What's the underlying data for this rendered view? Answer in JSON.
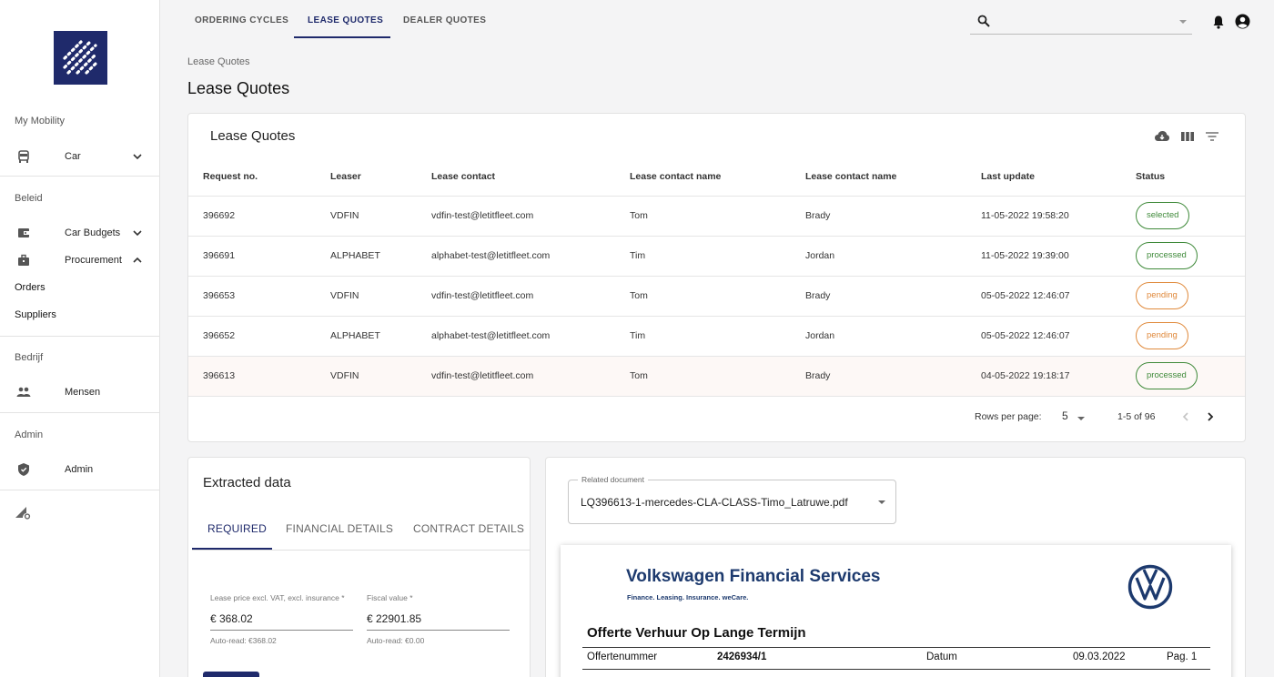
{
  "sidebar": {
    "logo": "brand-logo",
    "sections": {
      "my_mobility": "My Mobility",
      "beleid": "Beleid",
      "bedrijf": "Bedrijf",
      "admin": "Admin"
    },
    "items": {
      "car": "Car",
      "car_budgets": "Car Budgets",
      "procurement": "Procurement",
      "orders": "Orders",
      "suppliers": "Suppliers",
      "mensen": "Mensen",
      "admin": "Admin"
    }
  },
  "topbar": {
    "tabs": [
      "ORDERING CYCLES",
      "LEASE QUOTES",
      "DEALER QUOTES"
    ],
    "active_tab": "LEASE QUOTES",
    "search_placeholder": ""
  },
  "page": {
    "breadcrumb": "Lease Quotes",
    "title": "Lease Quotes"
  },
  "table": {
    "title": "Lease Quotes",
    "columns": [
      "Request no.",
      "Leaser",
      "Lease contact",
      "Lease contact name",
      "Lease contact name",
      "Last update",
      "Status"
    ],
    "rows": [
      {
        "request": "396692",
        "leaser": "VDFIN",
        "contact": "vdfin-test@letitfleet.com",
        "first": "Tom",
        "last": "Brady",
        "updated": "11-05-2022 19:58:20",
        "status": "selected"
      },
      {
        "request": "396691",
        "leaser": "ALPHABET",
        "contact": "alphabet-test@letitfleet.com",
        "first": "Tim",
        "last": "Jordan",
        "updated": "11-05-2022 19:39:00",
        "status": "processed"
      },
      {
        "request": "396653",
        "leaser": "VDFIN",
        "contact": "vdfin-test@letitfleet.com",
        "first": "Tom",
        "last": "Brady",
        "updated": "05-05-2022 12:46:07",
        "status": "pending"
      },
      {
        "request": "396652",
        "leaser": "ALPHABET",
        "contact": "alphabet-test@letitfleet.com",
        "first": "Tim",
        "last": "Jordan",
        "updated": "05-05-2022 12:46:07",
        "status": "pending"
      },
      {
        "request": "396613",
        "leaser": "VDFIN",
        "contact": "vdfin-test@letitfleet.com",
        "first": "Tom",
        "last": "Brady",
        "updated": "04-05-2022 19:18:17",
        "status": "processed"
      }
    ],
    "pagination": {
      "rows_per_page_label": "Rows per page:",
      "rows_per_page": "5",
      "range": "1-5 of 96"
    }
  },
  "extracted": {
    "title": "Extracted data",
    "tabs": [
      "REQUIRED",
      "FINANCIAL DETAILS",
      "CONTRACT DETAILS"
    ],
    "fields": [
      {
        "label": "Lease price excl. VAT, excl. insurance *",
        "value": "€  368.02",
        "help": "Auto-read: €368.02"
      },
      {
        "label": "Fiscal value *",
        "value": "€  22901.85",
        "help": "Auto-read: €0.00"
      }
    ]
  },
  "document": {
    "select_label": "Related document",
    "select_value": "LQ396613-1-mercedes-CLA-CLASS-Timo_Latruwe.pdf",
    "brand_title": "Volkswagen Financial Services",
    "brand_tagline": "Finance. Leasing. Insurance. weCare.",
    "heading": "Offerte Verhuur Op Lange Termijn",
    "row": {
      "label": "Offertenummer",
      "number": "2426934/1",
      "date_label": "Datum",
      "date": "09.03.2022",
      "page": "Pag. 1"
    }
  },
  "colors": {
    "brand": "#1f2a6b",
    "success": "#3f8a3a",
    "warning": "#e08a3c"
  }
}
